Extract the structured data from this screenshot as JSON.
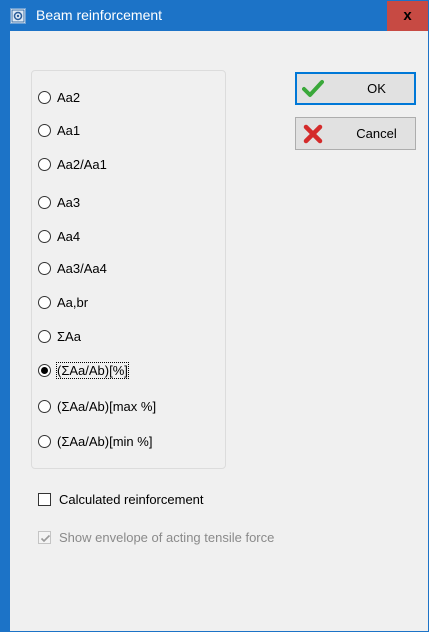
{
  "window": {
    "title": "Beam reinforcement",
    "close_label": "x",
    "app_icon": "app-icon"
  },
  "options": [
    {
      "label": "Aa2",
      "selected": false
    },
    {
      "label": "Aa1",
      "selected": false
    },
    {
      "label": "Aa2/Aa1",
      "selected": false
    },
    {
      "label": "Aa3",
      "selected": false
    },
    {
      "label": "Aa4",
      "selected": false
    },
    {
      "label": "Aa3/Aa4",
      "selected": false
    },
    {
      "label": "Aa,br",
      "selected": false
    },
    {
      "label": "ΣAa",
      "selected": false
    },
    {
      "label": "(ΣAa/Ab)[%]",
      "selected": true
    },
    {
      "label": "(ΣAa/Ab)[max %]",
      "selected": false
    },
    {
      "label": "(ΣAa/Ab)[min %]",
      "selected": false
    }
  ],
  "buttons": {
    "ok": {
      "label": "OK",
      "icon": "checkmark-icon",
      "icon_color": "#3aa83a"
    },
    "cancel": {
      "label": "Cancel",
      "icon": "x-icon",
      "icon_color": "#d42b2b"
    }
  },
  "checkboxes": {
    "calculated": {
      "label": "Calculated reinforcement",
      "checked": false,
      "enabled": true
    },
    "envelope": {
      "label": "Show envelope of acting tensile force",
      "checked": true,
      "enabled": false
    }
  },
  "colors": {
    "titlebar": "#1c73c7",
    "close_button": "#c74a43",
    "dialog_bg": "#f0f0f0"
  }
}
